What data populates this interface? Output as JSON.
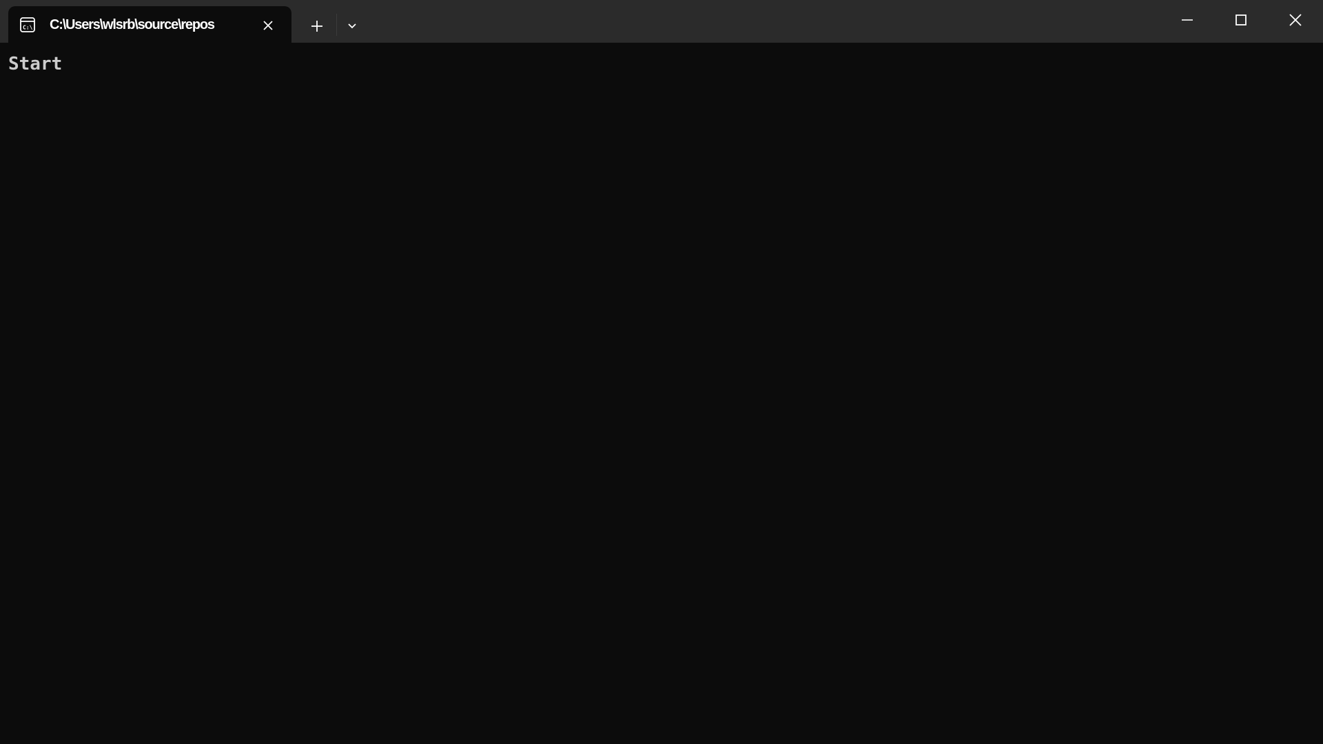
{
  "tab": {
    "title": "C:\\Users\\wlsrb\\source\\repos",
    "icon": "terminal-cmd-icon"
  },
  "toolbar": {
    "new_tab_icon": "plus-icon",
    "dropdown_icon": "chevron-down-icon"
  },
  "window_controls": {
    "minimize_icon": "minimize-icon",
    "maximize_icon": "maximize-icon",
    "close_icon": "close-icon"
  },
  "terminal": {
    "lines": [
      "Start"
    ]
  },
  "colors": {
    "titlebar": "#2b2b2b",
    "background": "#0c0c0c",
    "text": "#cccccc"
  }
}
